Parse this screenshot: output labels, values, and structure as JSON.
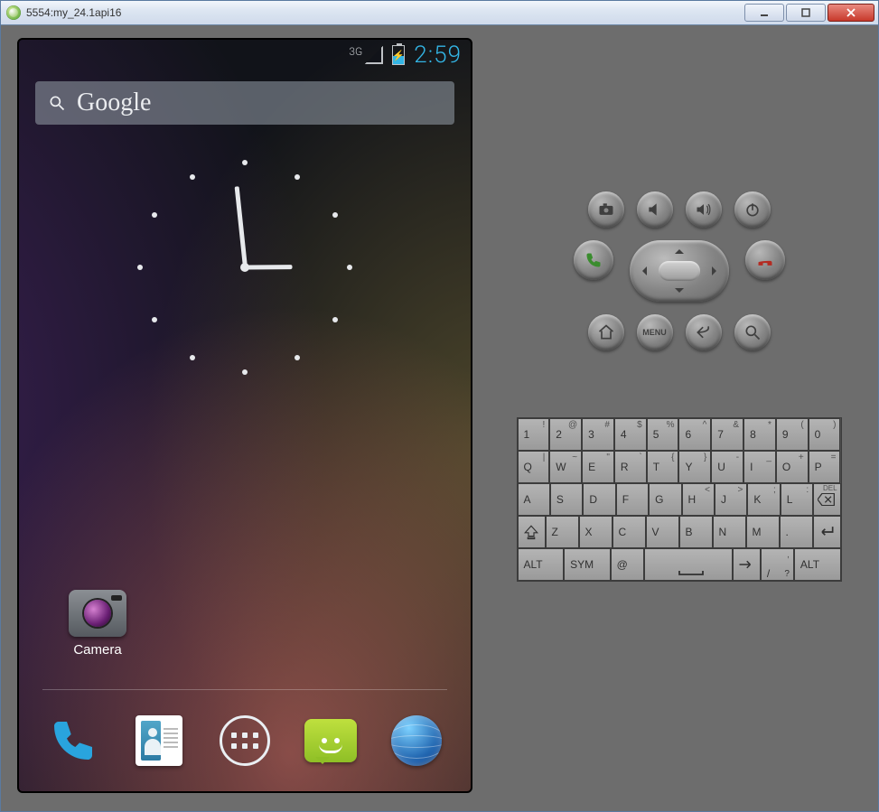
{
  "window": {
    "title": "5554:my_24.1api16",
    "buttons": {
      "minimize": "min",
      "maximize": "max",
      "close": "close"
    }
  },
  "status_bar": {
    "network": "3G",
    "battery_charging": true,
    "clock_text": "2:59"
  },
  "clock_widget": {
    "hour": 2,
    "minute": 59
  },
  "search": {
    "label": "Google"
  },
  "homescreen": {
    "apps": [
      {
        "name": "camera",
        "label": "Camera"
      }
    ]
  },
  "dock": {
    "items": [
      "phone",
      "contacts",
      "apps",
      "messaging",
      "browser"
    ]
  },
  "hw_buttons": {
    "row1": [
      "camera",
      "vol-down",
      "vol-up",
      "power"
    ],
    "row2": [
      "call",
      "dpad",
      "end-call"
    ],
    "row3_labels": {
      "home": "home",
      "menu": "MENU",
      "back": "back",
      "search": "search"
    }
  },
  "keyboard": {
    "rows": [
      [
        {
          "main": "1",
          "sup": "!"
        },
        {
          "main": "2",
          "sup": "@"
        },
        {
          "main": "3",
          "sup": "#"
        },
        {
          "main": "4",
          "sup": "$"
        },
        {
          "main": "5",
          "sup": "%"
        },
        {
          "main": "6",
          "sup": "^"
        },
        {
          "main": "7",
          "sup": "&"
        },
        {
          "main": "8",
          "sup": "*"
        },
        {
          "main": "9",
          "sup": "("
        },
        {
          "main": "0",
          "sup": ")"
        }
      ],
      [
        {
          "main": "Q",
          "sup": "|"
        },
        {
          "main": "W",
          "sup": "~"
        },
        {
          "main": "E",
          "sup": "\""
        },
        {
          "main": "R",
          "sup": "`"
        },
        {
          "main": "T",
          "sup": "{"
        },
        {
          "main": "Y",
          "sup": "}"
        },
        {
          "main": "U",
          "sup": "-"
        },
        {
          "main": "I",
          "sup": "_"
        },
        {
          "main": "O",
          "sup": "+"
        },
        {
          "main": "P",
          "sup": "="
        }
      ],
      [
        {
          "main": "A",
          "sup": ""
        },
        {
          "main": "S",
          "sup": ""
        },
        {
          "main": "D",
          "sup": ""
        },
        {
          "main": "F",
          "sup": ""
        },
        {
          "main": "G",
          "sup": ""
        },
        {
          "main": "H",
          "sup": "<"
        },
        {
          "main": "J",
          "sup": ">"
        },
        {
          "main": "K",
          "sup": ";"
        },
        {
          "main": "L",
          "sup": ":"
        },
        {
          "main": "DEL",
          "sup": "",
          "icon": "del"
        }
      ],
      [
        {
          "main": "⇧",
          "sup": "",
          "icon": "shift"
        },
        {
          "main": "Z",
          "sup": ""
        },
        {
          "main": "X",
          "sup": ""
        },
        {
          "main": "C",
          "sup": ""
        },
        {
          "main": "V",
          "sup": ""
        },
        {
          "main": "B",
          "sup": ""
        },
        {
          "main": "N",
          "sup": ""
        },
        {
          "main": "M",
          "sup": ""
        },
        {
          "main": ".",
          "sup": ""
        },
        {
          "main": "↵",
          "sup": "",
          "icon": "enter"
        }
      ],
      [
        {
          "main": "ALT",
          "sup": "",
          "w": "wide15"
        },
        {
          "main": "SYM",
          "sup": "",
          "w": "wide15"
        },
        {
          "main": "@",
          "sup": ""
        },
        {
          "main": "␣",
          "sup": "",
          "w": "sp",
          "icon": "space"
        },
        {
          "main": "→",
          "sup": "",
          "icon": "rarrow"
        },
        {
          "main": "/",
          "sup": ",",
          "sub": "?"
        },
        {
          "main": "ALT",
          "sup": "",
          "w": "wide15"
        }
      ]
    ]
  }
}
